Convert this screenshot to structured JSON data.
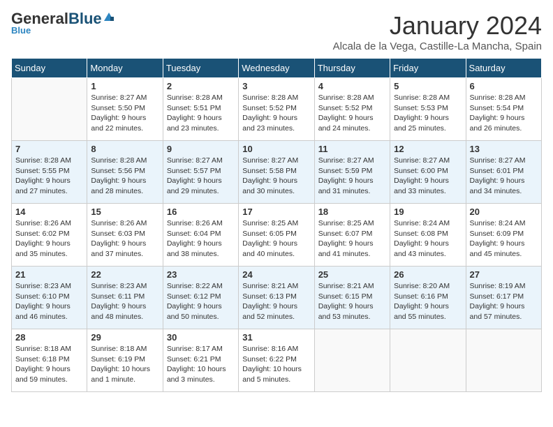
{
  "header": {
    "logo_general": "General",
    "logo_blue": "Blue",
    "month_title": "January 2024",
    "location": "Alcala de la Vega, Castille-La Mancha, Spain"
  },
  "weekdays": [
    "Sunday",
    "Monday",
    "Tuesday",
    "Wednesday",
    "Thursday",
    "Friday",
    "Saturday"
  ],
  "weeks": [
    [
      {
        "day": "",
        "sunrise": "",
        "sunset": "",
        "daylight": ""
      },
      {
        "day": "1",
        "sunrise": "Sunrise: 8:27 AM",
        "sunset": "Sunset: 5:50 PM",
        "daylight": "Daylight: 9 hours and 22 minutes."
      },
      {
        "day": "2",
        "sunrise": "Sunrise: 8:28 AM",
        "sunset": "Sunset: 5:51 PM",
        "daylight": "Daylight: 9 hours and 23 minutes."
      },
      {
        "day": "3",
        "sunrise": "Sunrise: 8:28 AM",
        "sunset": "Sunset: 5:52 PM",
        "daylight": "Daylight: 9 hours and 23 minutes."
      },
      {
        "day": "4",
        "sunrise": "Sunrise: 8:28 AM",
        "sunset": "Sunset: 5:52 PM",
        "daylight": "Daylight: 9 hours and 24 minutes."
      },
      {
        "day": "5",
        "sunrise": "Sunrise: 8:28 AM",
        "sunset": "Sunset: 5:53 PM",
        "daylight": "Daylight: 9 hours and 25 minutes."
      },
      {
        "day": "6",
        "sunrise": "Sunrise: 8:28 AM",
        "sunset": "Sunset: 5:54 PM",
        "daylight": "Daylight: 9 hours and 26 minutes."
      }
    ],
    [
      {
        "day": "7",
        "sunrise": "Sunrise: 8:28 AM",
        "sunset": "Sunset: 5:55 PM",
        "daylight": "Daylight: 9 hours and 27 minutes."
      },
      {
        "day": "8",
        "sunrise": "Sunrise: 8:28 AM",
        "sunset": "Sunset: 5:56 PM",
        "daylight": "Daylight: 9 hours and 28 minutes."
      },
      {
        "day": "9",
        "sunrise": "Sunrise: 8:27 AM",
        "sunset": "Sunset: 5:57 PM",
        "daylight": "Daylight: 9 hours and 29 minutes."
      },
      {
        "day": "10",
        "sunrise": "Sunrise: 8:27 AM",
        "sunset": "Sunset: 5:58 PM",
        "daylight": "Daylight: 9 hours and 30 minutes."
      },
      {
        "day": "11",
        "sunrise": "Sunrise: 8:27 AM",
        "sunset": "Sunset: 5:59 PM",
        "daylight": "Daylight: 9 hours and 31 minutes."
      },
      {
        "day": "12",
        "sunrise": "Sunrise: 8:27 AM",
        "sunset": "Sunset: 6:00 PM",
        "daylight": "Daylight: 9 hours and 33 minutes."
      },
      {
        "day": "13",
        "sunrise": "Sunrise: 8:27 AM",
        "sunset": "Sunset: 6:01 PM",
        "daylight": "Daylight: 9 hours and 34 minutes."
      }
    ],
    [
      {
        "day": "14",
        "sunrise": "Sunrise: 8:26 AM",
        "sunset": "Sunset: 6:02 PM",
        "daylight": "Daylight: 9 hours and 35 minutes."
      },
      {
        "day": "15",
        "sunrise": "Sunrise: 8:26 AM",
        "sunset": "Sunset: 6:03 PM",
        "daylight": "Daylight: 9 hours and 37 minutes."
      },
      {
        "day": "16",
        "sunrise": "Sunrise: 8:26 AM",
        "sunset": "Sunset: 6:04 PM",
        "daylight": "Daylight: 9 hours and 38 minutes."
      },
      {
        "day": "17",
        "sunrise": "Sunrise: 8:25 AM",
        "sunset": "Sunset: 6:05 PM",
        "daylight": "Daylight: 9 hours and 40 minutes."
      },
      {
        "day": "18",
        "sunrise": "Sunrise: 8:25 AM",
        "sunset": "Sunset: 6:07 PM",
        "daylight": "Daylight: 9 hours and 41 minutes."
      },
      {
        "day": "19",
        "sunrise": "Sunrise: 8:24 AM",
        "sunset": "Sunset: 6:08 PM",
        "daylight": "Daylight: 9 hours and 43 minutes."
      },
      {
        "day": "20",
        "sunrise": "Sunrise: 8:24 AM",
        "sunset": "Sunset: 6:09 PM",
        "daylight": "Daylight: 9 hours and 45 minutes."
      }
    ],
    [
      {
        "day": "21",
        "sunrise": "Sunrise: 8:23 AM",
        "sunset": "Sunset: 6:10 PM",
        "daylight": "Daylight: 9 hours and 46 minutes."
      },
      {
        "day": "22",
        "sunrise": "Sunrise: 8:23 AM",
        "sunset": "Sunset: 6:11 PM",
        "daylight": "Daylight: 9 hours and 48 minutes."
      },
      {
        "day": "23",
        "sunrise": "Sunrise: 8:22 AM",
        "sunset": "Sunset: 6:12 PM",
        "daylight": "Daylight: 9 hours and 50 minutes."
      },
      {
        "day": "24",
        "sunrise": "Sunrise: 8:21 AM",
        "sunset": "Sunset: 6:13 PM",
        "daylight": "Daylight: 9 hours and 52 minutes."
      },
      {
        "day": "25",
        "sunrise": "Sunrise: 8:21 AM",
        "sunset": "Sunset: 6:15 PM",
        "daylight": "Daylight: 9 hours and 53 minutes."
      },
      {
        "day": "26",
        "sunrise": "Sunrise: 8:20 AM",
        "sunset": "Sunset: 6:16 PM",
        "daylight": "Daylight: 9 hours and 55 minutes."
      },
      {
        "day": "27",
        "sunrise": "Sunrise: 8:19 AM",
        "sunset": "Sunset: 6:17 PM",
        "daylight": "Daylight: 9 hours and 57 minutes."
      }
    ],
    [
      {
        "day": "28",
        "sunrise": "Sunrise: 8:18 AM",
        "sunset": "Sunset: 6:18 PM",
        "daylight": "Daylight: 9 hours and 59 minutes."
      },
      {
        "day": "29",
        "sunrise": "Sunrise: 8:18 AM",
        "sunset": "Sunset: 6:19 PM",
        "daylight": "Daylight: 10 hours and 1 minute."
      },
      {
        "day": "30",
        "sunrise": "Sunrise: 8:17 AM",
        "sunset": "Sunset: 6:21 PM",
        "daylight": "Daylight: 10 hours and 3 minutes."
      },
      {
        "day": "31",
        "sunrise": "Sunrise: 8:16 AM",
        "sunset": "Sunset: 6:22 PM",
        "daylight": "Daylight: 10 hours and 5 minutes."
      },
      {
        "day": "",
        "sunrise": "",
        "sunset": "",
        "daylight": ""
      },
      {
        "day": "",
        "sunrise": "",
        "sunset": "",
        "daylight": ""
      },
      {
        "day": "",
        "sunrise": "",
        "sunset": "",
        "daylight": ""
      }
    ]
  ]
}
